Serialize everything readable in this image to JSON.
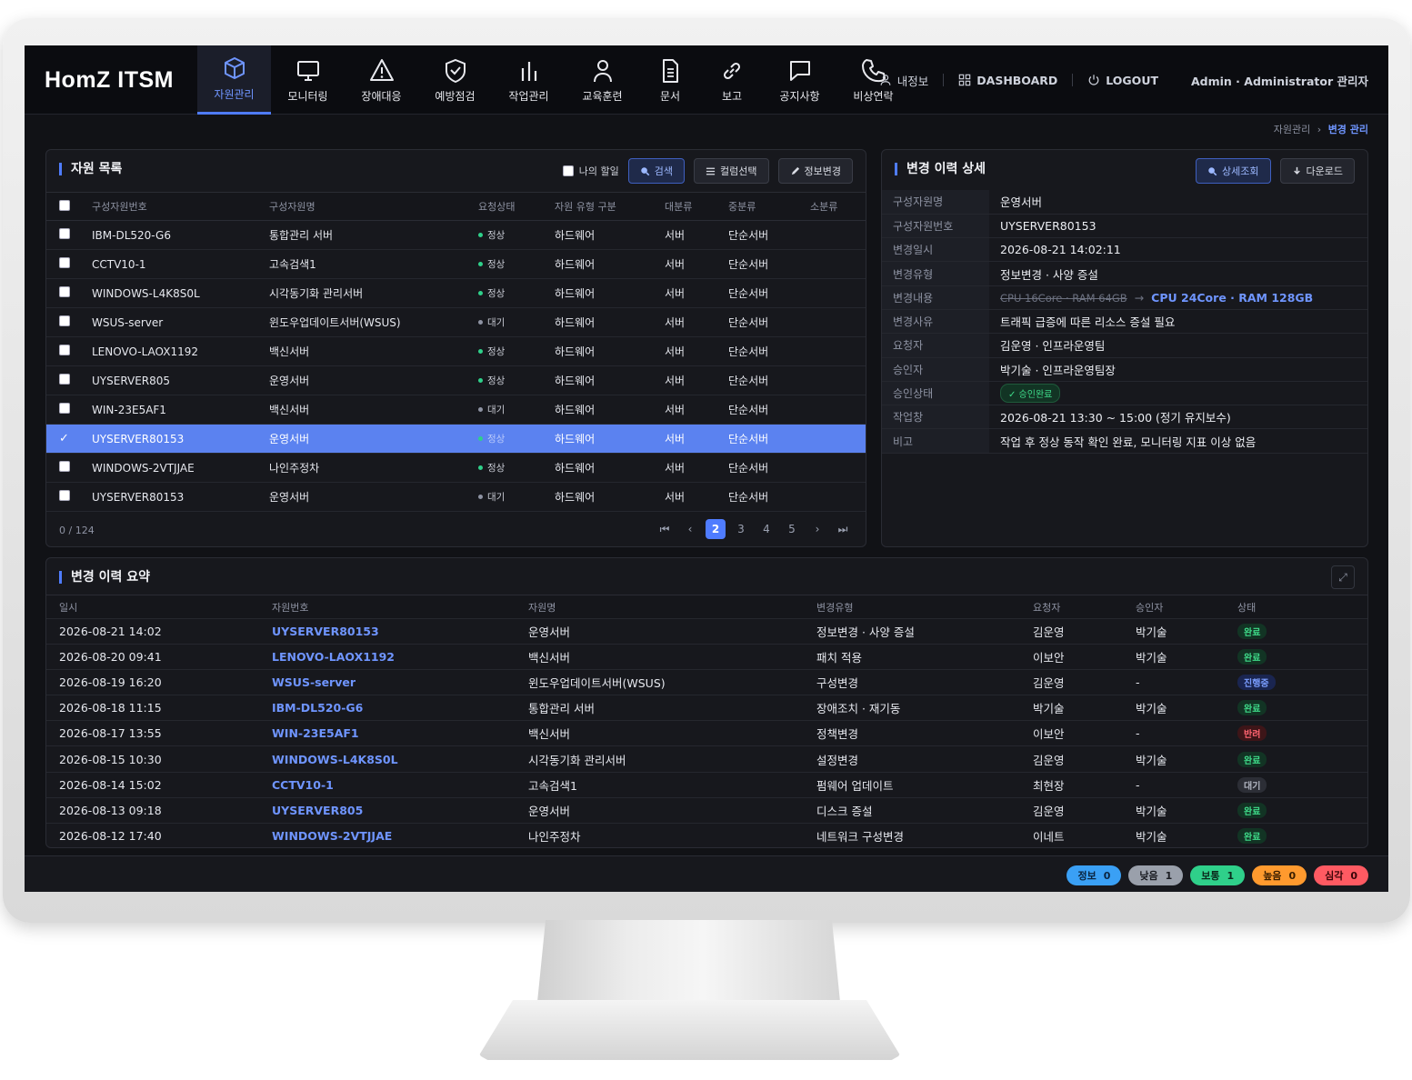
{
  "app": {
    "title": "HomZ ITSM"
  },
  "nav": [
    {
      "label": "자원관리",
      "icon": "cube-icon",
      "active": true
    },
    {
      "label": "모니터링",
      "icon": "monitor-icon"
    },
    {
      "label": "장애대응",
      "icon": "warning-icon"
    },
    {
      "label": "예방점검",
      "icon": "shield-check-icon"
    },
    {
      "label": "작업관리",
      "icon": "bar-chart-icon"
    },
    {
      "label": "교육훈련",
      "icon": "person-icon"
    },
    {
      "label": "문서",
      "icon": "document-icon"
    },
    {
      "label": "보고",
      "icon": "link-icon"
    },
    {
      "label": "공지사항",
      "icon": "chat-icon"
    },
    {
      "label": "비상연락",
      "icon": "phone-icon"
    }
  ],
  "util": {
    "myinfo": "내정보",
    "dashboard": "DASHBOARD",
    "logout": "LOGOUT",
    "admin": "Admin · Administrator 관리자"
  },
  "breadcrumb": {
    "parent": "자원관리",
    "sep": "›",
    "current": "변경 관리"
  },
  "list": {
    "title": "자원 목록",
    "my_tasks": "나의 할일",
    "btn_search": "검색",
    "btn_columns": "컬럼선택",
    "btn_edit": "정보변경",
    "columns": [
      "구성자원번호",
      "구성자원명",
      "요청상태",
      "자원 유형 구분",
      "대분류",
      "중분류",
      "소분류"
    ],
    "rows": [
      {
        "id": "IBM-DL520-G6",
        "name": "통합관리 서버",
        "status": "정상",
        "type": "하드웨어",
        "major": "서버",
        "mid": "단순서버",
        "minor": ""
      },
      {
        "id": "CCTV10-1",
        "name": "고속검색1",
        "status": "정상",
        "type": "하드웨어",
        "major": "서버",
        "mid": "단순서버",
        "minor": ""
      },
      {
        "id": "WINDOWS-L4K8S0L",
        "name": "시각동기화 관리서버",
        "status": "정상",
        "type": "하드웨어",
        "major": "서버",
        "mid": "단순서버",
        "minor": ""
      },
      {
        "id": "WSUS-server",
        "name": "윈도우업데이트서버(WSUS)",
        "status": "대기",
        "type": "하드웨어",
        "major": "서버",
        "mid": "단순서버",
        "minor": ""
      },
      {
        "id": "LENOVO-LAOX1192",
        "name": "백신서버",
        "status": "정상",
        "type": "하드웨어",
        "major": "서버",
        "mid": "단순서버",
        "minor": ""
      },
      {
        "id": "UYSERVER805",
        "name": "운영서버",
        "status": "정상",
        "type": "하드웨어",
        "major": "서버",
        "mid": "단순서버",
        "minor": ""
      },
      {
        "id": "WIN-23E5AF1",
        "name": "백신서버",
        "status": "대기",
        "type": "하드웨어",
        "major": "서버",
        "mid": "단순서버",
        "minor": ""
      },
      {
        "id": "UYSERVER80153",
        "name": "운영서버",
        "status": "정상",
        "type": "하드웨어",
        "major": "서버",
        "mid": "단순서버",
        "minor": "",
        "selected": true
      },
      {
        "id": "WINDOWS-2VTJJAE",
        "name": "나인주정차",
        "status": "정상",
        "type": "하드웨어",
        "major": "서버",
        "mid": "단순서버",
        "minor": ""
      },
      {
        "id": "UYSERVER80153",
        "name": "운영서버",
        "status": "대기",
        "type": "하드웨어",
        "major": "서버",
        "mid": "단순서버",
        "minor": ""
      }
    ],
    "count": "0 / 124",
    "pages": [
      "2",
      "3",
      "4",
      "5"
    ],
    "current_page": "2"
  },
  "detail": {
    "title": "변경 이력 상세",
    "btn_view": "상세조회",
    "btn_download": "다운로드",
    "fields": [
      {
        "key": "구성자원명",
        "value": "운영서버"
      },
      {
        "key": "구성자원번호",
        "value": "UYSERVER80153"
      },
      {
        "key": "변경일시",
        "value": "2026-08-21 14:02:11"
      },
      {
        "key": "변경유형",
        "value": "정보변경 · 사양 증설"
      },
      {
        "key": "변경내용",
        "old": "CPU 16Core · RAM 64GB",
        "arrow": "→",
        "new": "CPU 24Core · RAM 128GB"
      },
      {
        "key": "변경사유",
        "value": "트래픽 급증에 따른 리소스 증설 필요"
      },
      {
        "key": "요청자",
        "value": "김운영 · 인프라운영팀"
      },
      {
        "key": "승인자",
        "value": "박기술 · 인프라운영팀장"
      },
      {
        "key": "승인상태",
        "badge": "✓ 승인완료"
      },
      {
        "key": "작업창",
        "value": "2026-08-21 13:30 ~ 15:00 (정기 유지보수)"
      },
      {
        "key": "비고",
        "value": "작업 후 정상 동작 확인 완료, 모니터링 지표 이상 없음"
      }
    ]
  },
  "summary": {
    "title": "변경 이력 요약",
    "columns": [
      "일시",
      "자원번호",
      "자원명",
      "변경유형",
      "요청자",
      "승인자",
      "상태"
    ],
    "rows": [
      {
        "date": "2026-08-21 14:02",
        "id": "UYSERVER80153",
        "name": "운영서버",
        "type": "정보변경 · 사양 증설",
        "req": "김운영",
        "appr": "박기술",
        "state": "완료",
        "kind": "done"
      },
      {
        "date": "2026-08-20 09:41",
        "id": "LENOVO-LAOX1192",
        "name": "백신서버",
        "type": "패치 적용",
        "req": "이보안",
        "appr": "박기술",
        "state": "완료",
        "kind": "done"
      },
      {
        "date": "2026-08-19 16:20",
        "id": "WSUS-server",
        "name": "윈도우업데이트서버(WSUS)",
        "type": "구성변경",
        "req": "김운영",
        "appr": "-",
        "state": "진행중",
        "kind": "prog"
      },
      {
        "date": "2026-08-18 11:15",
        "id": "IBM-DL520-G6",
        "name": "통합관리 서버",
        "type": "장애조치 · 재기동",
        "req": "박기술",
        "appr": "박기술",
        "state": "완료",
        "kind": "done"
      },
      {
        "date": "2026-08-17 13:55",
        "id": "WIN-23E5AF1",
        "name": "백신서버",
        "type": "정책변경",
        "req": "이보안",
        "appr": "-",
        "state": "반려",
        "kind": "rej"
      },
      {
        "date": "2026-08-15 10:30",
        "id": "WINDOWS-L4K8S0L",
        "name": "시각동기화 관리서버",
        "type": "설정변경",
        "req": "김운영",
        "appr": "박기술",
        "state": "완료",
        "kind": "done"
      },
      {
        "date": "2026-08-14 15:02",
        "id": "CCTV10-1",
        "name": "고속검색1",
        "type": "펌웨어 업데이트",
        "req": "최현장",
        "appr": "-",
        "state": "대기",
        "kind": "wait"
      },
      {
        "date": "2026-08-13 09:18",
        "id": "UYSERVER805",
        "name": "운영서버",
        "type": "디스크 증설",
        "req": "김운영",
        "appr": "박기술",
        "state": "완료",
        "kind": "done"
      },
      {
        "date": "2026-08-12 17:40",
        "id": "WINDOWS-2VTJJAE",
        "name": "나인주정차",
        "type": "네트워크 구성변경",
        "req": "이네트",
        "appr": "박기술",
        "state": "완료",
        "kind": "done"
      }
    ]
  },
  "status_pills": [
    {
      "label": "정보",
      "count": "0",
      "bg": "#3aa0f5",
      "fg": "#0b2540"
    },
    {
      "label": "낮음",
      "count": "1",
      "bg": "#9aa0ab",
      "fg": "#1a1c22"
    },
    {
      "label": "보통",
      "count": "1",
      "bg": "#2fd08a",
      "fg": "#0b2a1c"
    },
    {
      "label": "높음",
      "count": "0",
      "bg": "#ff9a2e",
      "fg": "#3a1e00"
    },
    {
      "label": "심각",
      "count": "0",
      "bg": "#ff5a62",
      "fg": "#3a0508"
    }
  ],
  "colors": {
    "accent": "#4f7cff",
    "selected_row": "#5b82f0",
    "ok": "#2fd08a",
    "idle": "#8e93a3"
  }
}
